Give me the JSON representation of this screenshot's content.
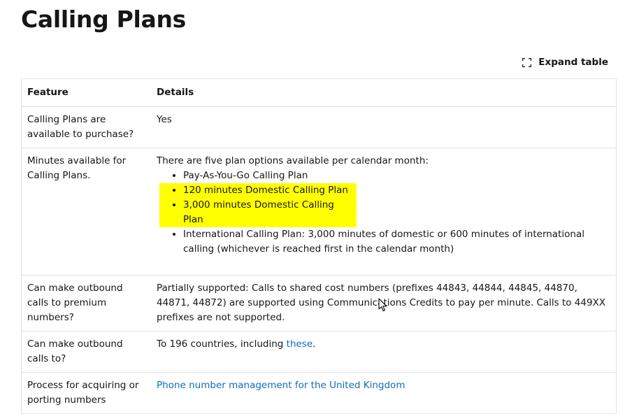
{
  "title": "Calling Plans",
  "expand_label": "Expand table",
  "table": {
    "headers": [
      "Feature",
      "Details"
    ],
    "rows": {
      "purchase": {
        "feature": "Calling Plans are available to purchase?",
        "details": "Yes"
      },
      "minutes": {
        "feature": "Minutes available for Calling Plans.",
        "intro": "There are five plan options available per calendar month:",
        "items": [
          "Pay-As-You-Go Calling Plan",
          "120 minutes Domestic Calling Plan",
          "3,000 minutes Domestic Calling Plan",
          "International Calling Plan: 3,000 minutes of domestic or 600 minutes of international calling (whichever is reached first in the calendar month)"
        ]
      },
      "premium": {
        "feature": "Can make outbound calls to premium numbers?",
        "details": "Partially supported: Calls to shared cost numbers (prefixes 44843, 44844, 44845, 44870, 44871, 44872) are supported using Communications Credits to pay per minute. Calls to 449XX prefixes are not supported."
      },
      "outbound": {
        "feature": "Can make outbound calls to?",
        "details_prefix": "To 196 countries, including ",
        "details_link": "these",
        "details_suffix": "."
      },
      "porting": {
        "feature": "Process for acquiring or porting numbers",
        "details_link": "Phone number management for the United Kingdom"
      }
    }
  },
  "colors": {
    "highlight": "#ffff00",
    "link": "#0f6cbd",
    "border": "#e1e1e1"
  }
}
